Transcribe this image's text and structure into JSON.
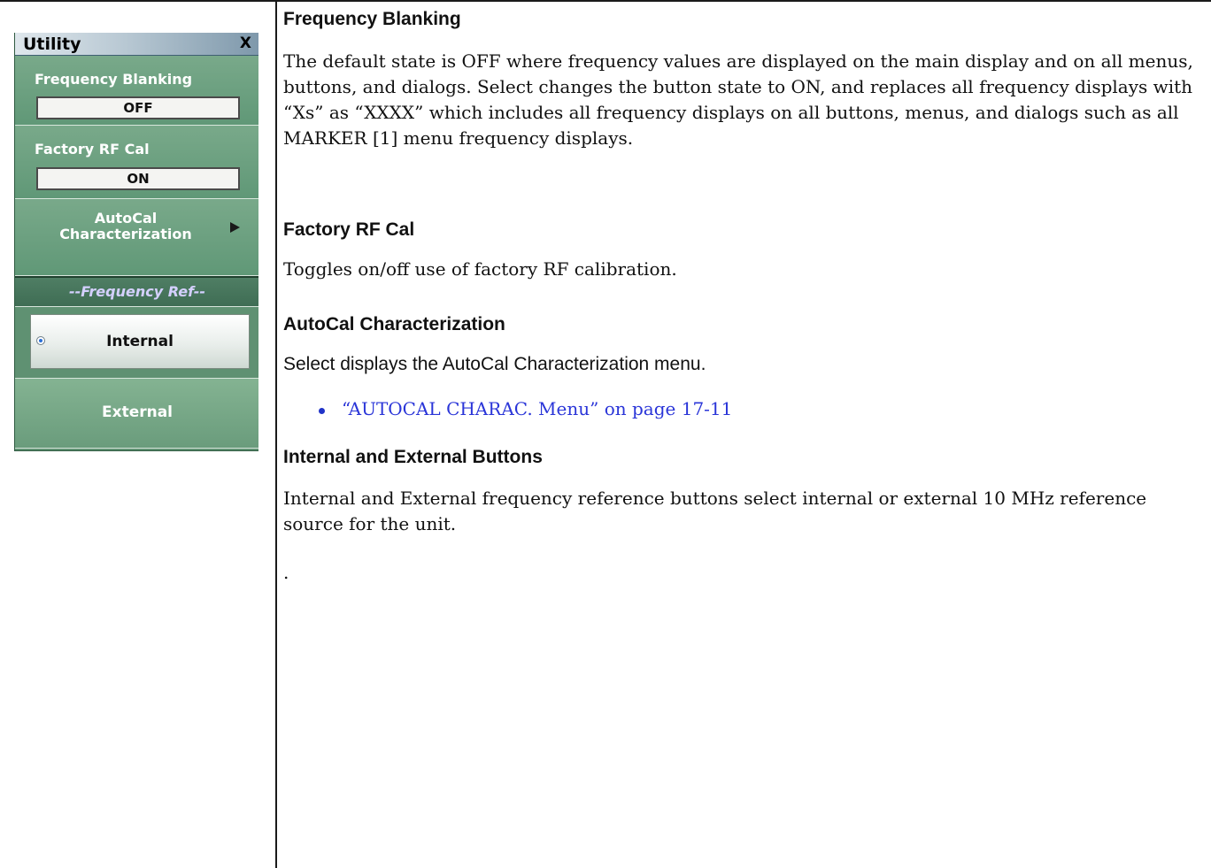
{
  "menu": {
    "title": "Utility",
    "close_label": "X",
    "frequency_blanking": {
      "label": "Frequency Blanking",
      "value": "OFF"
    },
    "factory_rf_cal": {
      "label": "Factory RF Cal",
      "value": "ON"
    },
    "autocal_label": "AutoCal Characterization",
    "freq_ref_header": "--Frequency Ref--",
    "internal_label": "Internal",
    "external_label": "External",
    "selected_reference": "Internal"
  },
  "content": {
    "sections": [
      {
        "heading": "Frequency Blanking",
        "body": "The default state is OFF where frequency values are displayed on the main display and on all menus, buttons, and dialogs. Select changes the button state to ON, and replaces all frequency displays with “Xs” as “XXXX” which includes all frequency displays on all buttons, menus, and dialogs such as all MARKER [1] menu frequency displays."
      },
      {
        "heading": "Factory RF Cal",
        "body": "Toggles on/off use of factory RF calibration."
      },
      {
        "heading": "AutoCal Characterization",
        "body": "Select displays the AutoCal Characterization menu.",
        "link": "“AUTOCAL CHARAC. Menu” on page 17-11"
      },
      {
        "heading": "Internal and External Buttons",
        "body": "Internal and External frequency reference buttons select internal or external 10 MHz reference source for the unit."
      }
    ],
    "trailing_text": "."
  },
  "colors": {
    "menu_bg": "#5f9172",
    "freq_ref_text": "#d4d0ff",
    "link": "#2a35d8",
    "bullet": "#2033c8"
  }
}
